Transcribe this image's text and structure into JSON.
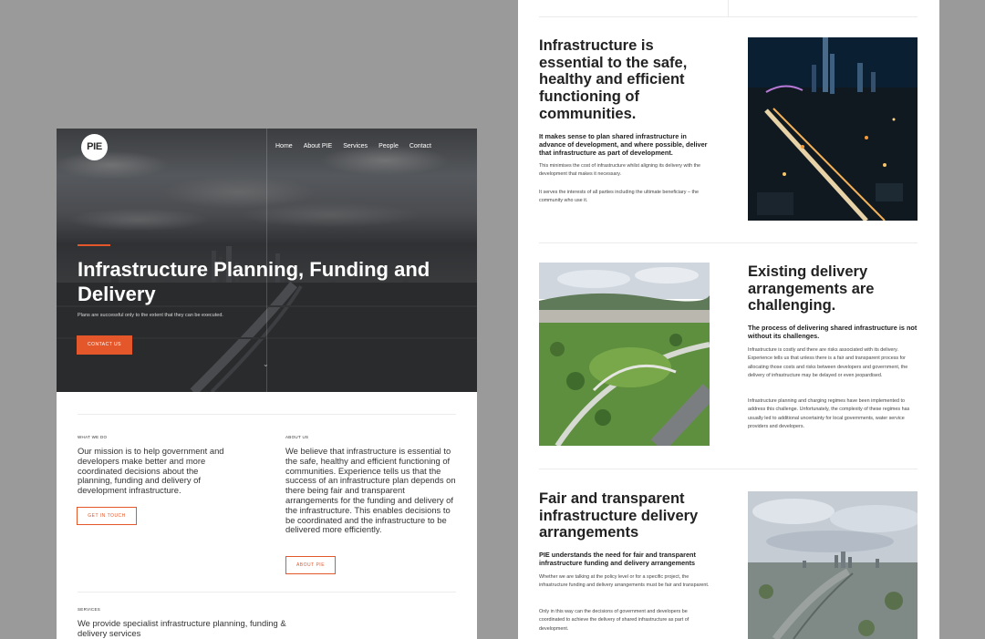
{
  "left": {
    "logo": "PIE",
    "nav": [
      "Home",
      "About PIE",
      "Services",
      "People",
      "Contact"
    ],
    "hero": {
      "title": "Infrastructure Planning, Funding and Delivery",
      "subtitle": "Plans are successful only to the extent that they can be executed.",
      "cta": "CONTACT US"
    },
    "what_we_do": {
      "label": "WHAT WE DO",
      "text": "Our mission is to help government and developers make better and more coordinated decisions about the planning, funding and delivery of development infrastructure.",
      "button": "GET IN TOUCH"
    },
    "about_us": {
      "label": "ABOUT US",
      "text": "We believe that infrastructure is essential to the safe, healthy and efficient functioning of communities. Experience tells us that the success of an infrastructure plan depends on there being fair and transparent arrangements for the funding and delivery of the infrastructure. This enables decisions to be coordinated and the infrastructure to be delivered more efficiently.",
      "button": "ABOUT PIE"
    },
    "services": {
      "label": "SERVICES",
      "text": "We provide specialist infrastructure planning, funding & delivery services"
    }
  },
  "right": {
    "section1": {
      "heading": "Infrastructure is essential to the safe, healthy and efficient functioning of communities.",
      "subheading": "It makes sense to plan shared infrastructure in advance of development, and where possible, deliver that infrastructure as part of development.",
      "p1": "This minimises the cost of infrastructure whilst aligning its delivery with the development that makes it necessary.",
      "p2": "It serves the interests of all parties including the ultimate beneficiary – the community who use it."
    },
    "section2": {
      "heading": "Existing delivery arrangements are challenging.",
      "subheading": "The process of delivering shared infrastructure is not without its challenges.",
      "p1": "Infrastructure is costly and there are risks associated with its delivery. Experience tells us that unless there is a fair and transparent process for allocating those costs and risks between developers and government, the delivery of infrastructure may be delayed or even jeopardised.",
      "p2": "Infrastructure planning and charging regimes have been implemented to address this challenge. Unfortunately, the complexity of these regimes has usually led to additional uncertainty for local governments, water service providers and developers."
    },
    "section3": {
      "heading": "Fair and transparent infrastructure delivery arrangements",
      "subheading": "PIE understands the need for fair and transparent infrastructure funding and delivery arrangements",
      "p1": "Whether we are talking at the policy level or for a specific project, the infrastructure funding and delivery arrangements must be fair and transparent.",
      "p2": "Only in this way can the decisions of government and developers be coordinated to achieve the delivery of shared infrastructure as part of development."
    }
  },
  "colors": {
    "accent": "#e3572a",
    "background": "#9a9a9a"
  }
}
